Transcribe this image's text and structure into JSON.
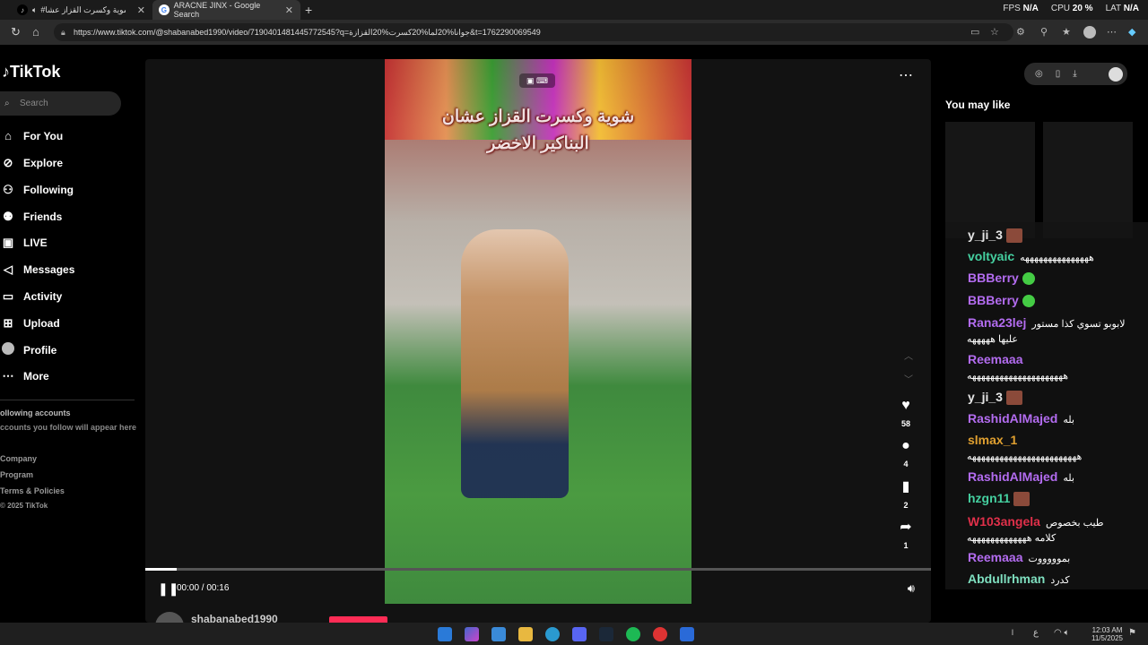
{
  "browser": {
    "tabs": [
      {
        "title": "#جوان شوية وكسرت القزاز عشا",
        "icon": "tiktok-icon"
      },
      {
        "title": "ARACNE JINX - Google Search",
        "icon": "google-icon"
      }
    ],
    "url": "https://www.tiktok.com/@shabanabed1990/video/7190401481445772545?q=جوانا%20لما%20كسرت%20القزازة&t=1762290069549",
    "perf": {
      "fps_label": "FPS",
      "fps": "N/A",
      "cpu_label": "CPU",
      "cpu": "20 %",
      "lat_label": "LAT",
      "lat": "N/A"
    }
  },
  "sidebar": {
    "logo": "TikTok",
    "search_placeholder": "Search",
    "nav": [
      {
        "label": "For You",
        "icon": "home-icon"
      },
      {
        "label": "Explore",
        "icon": "compass-icon"
      },
      {
        "label": "Following",
        "icon": "user-follow-icon"
      },
      {
        "label": "Friends",
        "icon": "friends-icon"
      },
      {
        "label": "LIVE",
        "icon": "live-icon"
      },
      {
        "label": "Messages",
        "icon": "messages-icon"
      },
      {
        "label": "Activity",
        "icon": "activity-icon"
      },
      {
        "label": "Upload",
        "icon": "upload-icon"
      },
      {
        "label": "Profile",
        "icon": "profile-icon"
      },
      {
        "label": "More",
        "icon": "more-icon"
      }
    ],
    "following_title": "ollowing accounts",
    "following_desc": "ccounts you follow will appear here",
    "footer": [
      "Company",
      "Program",
      "Terms & Policies",
      "© 2025 TikTok"
    ]
  },
  "player": {
    "caption": "شوية وكسرت القزاز عشان البناكير الاخضر",
    "time": "00:00 / 00:16",
    "progress": 0.04,
    "likes": "58",
    "comments": "4",
    "saves": "2",
    "shares": "1",
    "author": "shabanabed1990"
  },
  "right": {
    "you_may_like": "You may like"
  },
  "chat": [
    {
      "user": "y_ji_3",
      "color": "#e5e5e5",
      "text": "",
      "emote": true
    },
    {
      "user": "voltyaic",
      "color": "#45d0a0",
      "text": "هههههههههههههههه"
    },
    {
      "user": "BBBerry",
      "color": "#b36cf0",
      "text": "",
      "emote_green": true
    },
    {
      "user": "BBBerry",
      "color": "#b36cf0",
      "text": "",
      "emote_green": true
    },
    {
      "user": "Rana23lej",
      "color": "#b36cf0",
      "text": "لابوبو تسوي كذا مستور",
      "text2": "عليها هههههه"
    },
    {
      "user": "Reemaaa",
      "color": "#b36cf0",
      "text": "",
      "text2": "هههههههههههههههههههههه"
    },
    {
      "user": "y_ji_3",
      "color": "#e5e5e5",
      "text": "",
      "emote": true
    },
    {
      "user": "RashidAlMajed",
      "color": "#b36cf0",
      "text": "بله"
    },
    {
      "user": "slmax_1",
      "color": "#e0a030",
      "text": "",
      "text2": "ههههههههههههههههههههههههه"
    },
    {
      "user": "RashidAlMajed",
      "color": "#b36cf0",
      "text": "بله"
    },
    {
      "user": "hzgn11",
      "color": "#45d0a0",
      "text": "",
      "emote": true
    },
    {
      "user": "W103angela",
      "color": "#e0304a",
      "text": "طيب بخصوص",
      "text2": "كلامه هههههههههههههه"
    },
    {
      "user": "Reemaaa",
      "color": "#b36cf0",
      "text": "بموووووت"
    },
    {
      "user": "Abdullrhman",
      "color": "#7fe0c0",
      "text": "كدرد"
    }
  ],
  "taskbar": {
    "time": "12:03 AM",
    "date": "11/5/2025"
  }
}
